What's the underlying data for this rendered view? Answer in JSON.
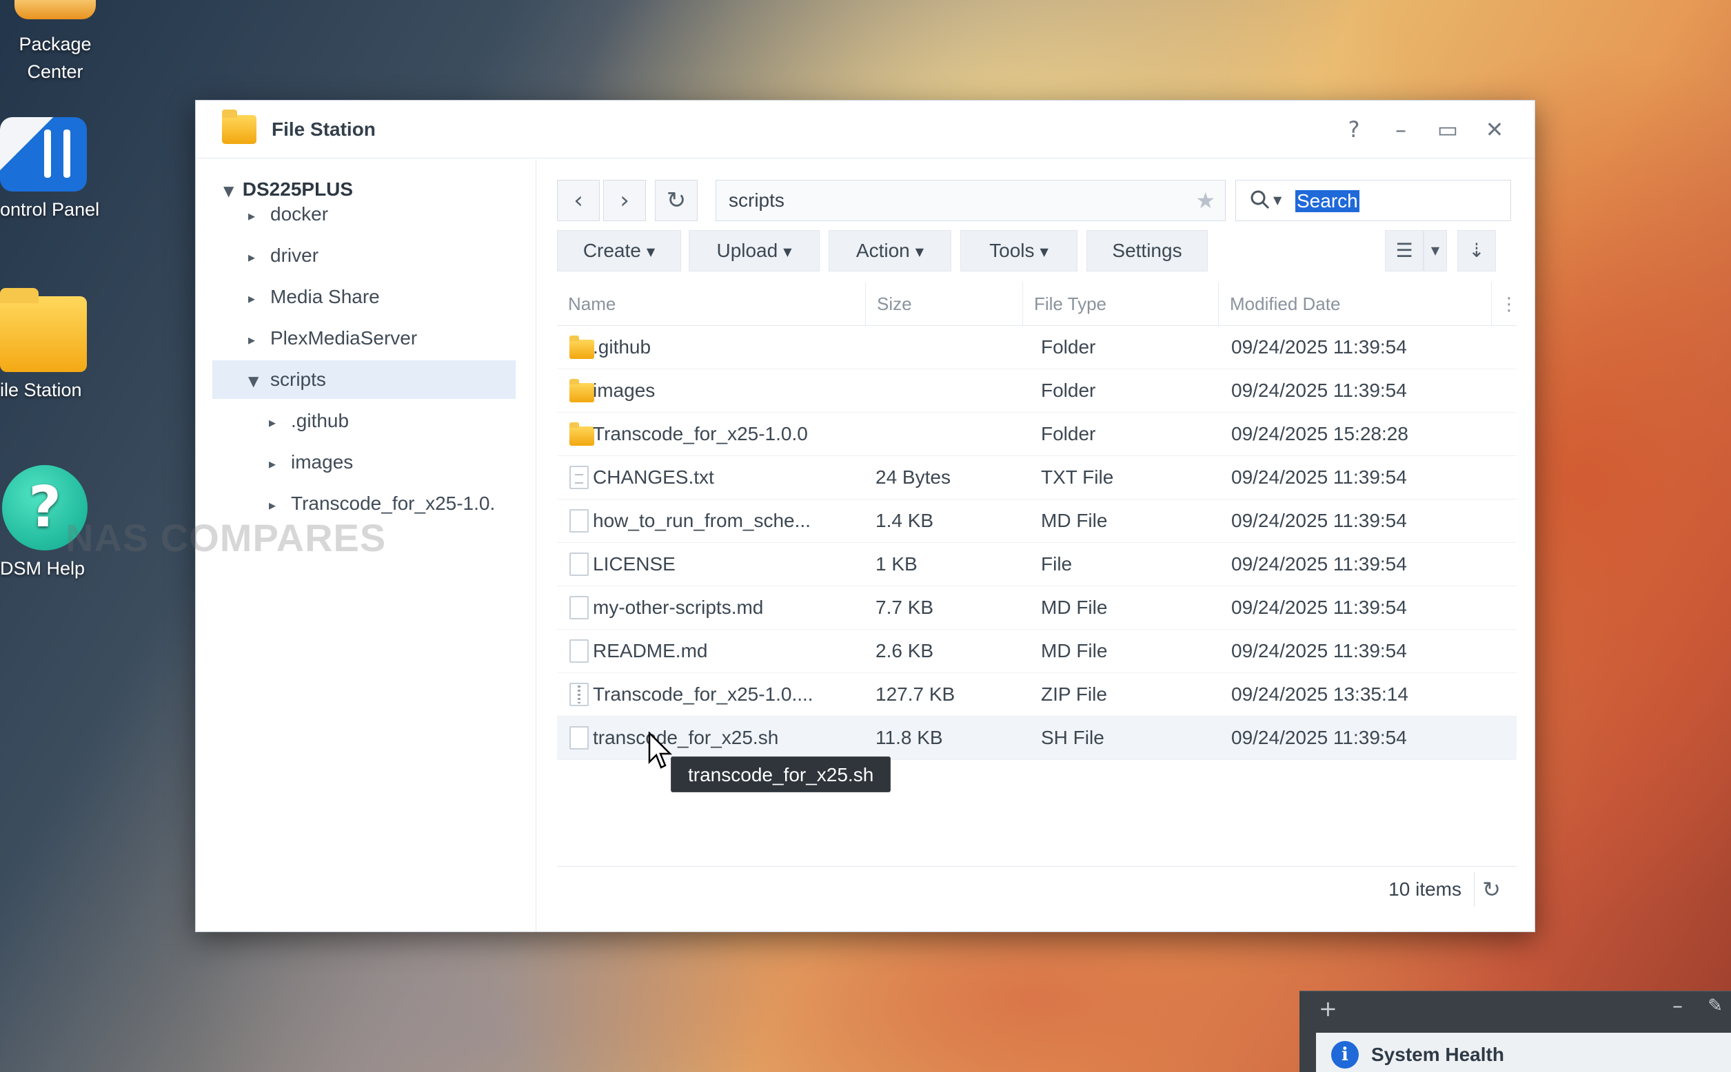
{
  "desktop": {
    "icons": [
      {
        "label_line1": "Package",
        "label_line2": "Center"
      },
      {
        "label": "ontrol Panel"
      },
      {
        "label": "ile Station"
      },
      {
        "label": "DSM Help",
        "glyph": "?"
      }
    ]
  },
  "watermark": "NAS COMPARES",
  "window": {
    "title": "File Station",
    "controls": {
      "help": "?",
      "minimize": "–",
      "maximize": "▭",
      "close": "✕"
    }
  },
  "tree": {
    "root": "DS225PLUS",
    "items": [
      {
        "label": "docker"
      },
      {
        "label": "driver"
      },
      {
        "label": "Media Share"
      },
      {
        "label": "PlexMediaServer"
      },
      {
        "label": "scripts"
      },
      {
        "label": ".github"
      },
      {
        "label": "images"
      },
      {
        "label": "Transcode_for_x25-1.0."
      }
    ]
  },
  "toolbar": {
    "path": "scripts",
    "search_placeholder": "Search",
    "buttons": {
      "create": "Create",
      "upload": "Upload",
      "action": "Action",
      "tools": "Tools",
      "settings": "Settings"
    }
  },
  "table": {
    "columns": [
      "Name",
      "Size",
      "File Type",
      "Modified Date"
    ],
    "rows": [
      {
        "name": ".github",
        "size": "",
        "type": "Folder",
        "date": "09/24/2025 11:39:54",
        "icon": "folder"
      },
      {
        "name": "images",
        "size": "",
        "type": "Folder",
        "date": "09/24/2025 11:39:54",
        "icon": "folder"
      },
      {
        "name": "Transcode_for_x25-1.0.0",
        "size": "",
        "type": "Folder",
        "date": "09/24/2025 15:28:28",
        "icon": "folder"
      },
      {
        "name": "CHANGES.txt",
        "size": "24 Bytes",
        "type": "TXT File",
        "date": "09/24/2025 11:39:54",
        "icon": "txt"
      },
      {
        "name": "how_to_run_from_sche...",
        "size": "1.4 KB",
        "type": "MD File",
        "date": "09/24/2025 11:39:54",
        "icon": "doc"
      },
      {
        "name": "LICENSE",
        "size": "1 KB",
        "type": "File",
        "date": "09/24/2025 11:39:54",
        "icon": "doc"
      },
      {
        "name": "my-other-scripts.md",
        "size": "7.7 KB",
        "type": "MD File",
        "date": "09/24/2025 11:39:54",
        "icon": "doc"
      },
      {
        "name": "README.md",
        "size": "2.6 KB",
        "type": "MD File",
        "date": "09/24/2025 11:39:54",
        "icon": "doc"
      },
      {
        "name": "Transcode_for_x25-1.0....",
        "size": "127.7 KB",
        "type": "ZIP File",
        "date": "09/24/2025 13:35:14",
        "icon": "zip"
      },
      {
        "name": "transcode_for_x25.sh",
        "size": "11.8 KB",
        "type": "SH File",
        "date": "09/24/2025 11:39:54",
        "icon": "doc"
      }
    ]
  },
  "footer": {
    "items_count": "10 items"
  },
  "tooltip": "transcode_for_x25.sh",
  "health_widget": {
    "title": "System Health",
    "add": "+",
    "minimize": "–",
    "pin": "📌"
  }
}
